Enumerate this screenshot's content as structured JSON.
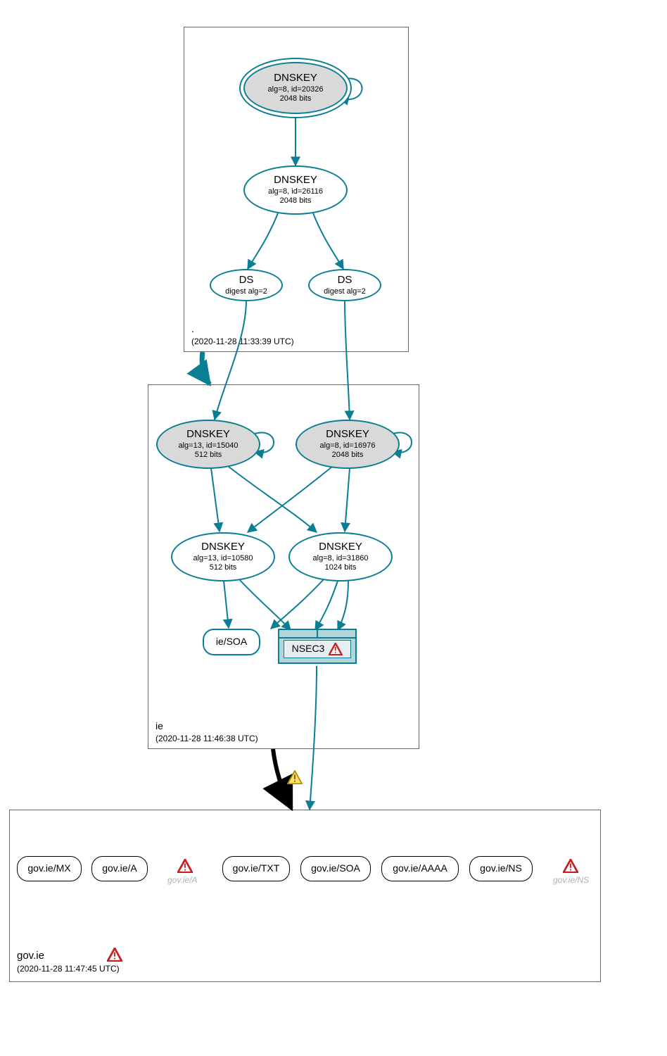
{
  "colors": {
    "teal": "#0a7e93",
    "gray_fill": "#d9d9d9",
    "black": "#000000"
  },
  "zones": {
    "root": {
      "title": ".",
      "timestamp": "(2020-11-28 11:33:39 UTC)"
    },
    "ie": {
      "title": "ie",
      "timestamp": "(2020-11-28 11:46:38 UTC)"
    },
    "gov": {
      "title": "gov.ie",
      "timestamp": "(2020-11-28 11:47:45 UTC)"
    }
  },
  "nodes": {
    "root_ksk": {
      "lines": [
        "DNSKEY",
        "alg=8, id=20326",
        "2048 bits"
      ]
    },
    "root_zsk": {
      "lines": [
        "DNSKEY",
        "alg=8, id=26116",
        "2048 bits"
      ]
    },
    "ds_left": {
      "lines": [
        "DS",
        "digest alg=2"
      ]
    },
    "ds_right": {
      "lines": [
        "DS",
        "digest alg=2"
      ]
    },
    "ie_ksk_l": {
      "lines": [
        "DNSKEY",
        "alg=13, id=15040",
        "512 bits"
      ]
    },
    "ie_ksk_r": {
      "lines": [
        "DNSKEY",
        "alg=8, id=16976",
        "2048 bits"
      ]
    },
    "ie_zsk_l": {
      "lines": [
        "DNSKEY",
        "alg=13, id=10580",
        "512 bits"
      ]
    },
    "ie_zsk_r": {
      "lines": [
        "DNSKEY",
        "alg=8, id=31860",
        "1024 bits"
      ]
    },
    "ie_soa": {
      "label": "ie/SOA"
    },
    "nsec3": {
      "label": "NSEC3"
    },
    "gov_mx": {
      "label": "gov.ie/MX"
    },
    "gov_a": {
      "label": "gov.ie/A"
    },
    "gov_txt": {
      "label": "gov.ie/TXT"
    },
    "gov_soa": {
      "label": "gov.ie/SOA"
    },
    "gov_aaaa": {
      "label": "gov.ie/AAAA"
    },
    "gov_ns": {
      "label": "gov.ie/NS"
    },
    "ghost_a": {
      "label": "gov.ie/A"
    },
    "ghost_ns": {
      "label": "gov.ie/NS"
    }
  },
  "icons": {
    "error": "error-triangle",
    "warning": "warning-triangle"
  }
}
